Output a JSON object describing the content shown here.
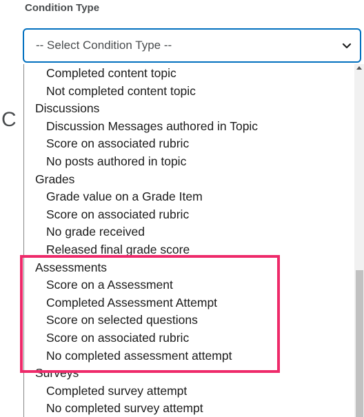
{
  "field_label": "Condition Type",
  "select": {
    "value": "-- Select Condition Type --",
    "chevron_icon": "chevron-down-icon"
  },
  "behind_letter": "C",
  "options": [
    {
      "type": "item",
      "label": "Completed content topic"
    },
    {
      "type": "item",
      "label": "Not completed content topic"
    },
    {
      "type": "group",
      "label": "Discussions"
    },
    {
      "type": "item",
      "label": "Discussion Messages authored in Topic"
    },
    {
      "type": "item",
      "label": "Score on associated rubric"
    },
    {
      "type": "item",
      "label": "No posts authored in topic"
    },
    {
      "type": "group",
      "label": "Grades"
    },
    {
      "type": "item",
      "label": "Grade value on a Grade Item"
    },
    {
      "type": "item",
      "label": "Score on associated rubric"
    },
    {
      "type": "item",
      "label": "No grade received"
    },
    {
      "type": "item",
      "label": "Released final grade score"
    },
    {
      "type": "group",
      "label": "Assessments"
    },
    {
      "type": "item",
      "label": "Score on a Assessment"
    },
    {
      "type": "item",
      "label": "Completed Assessment Attempt"
    },
    {
      "type": "item",
      "label": "Score on selected questions"
    },
    {
      "type": "item",
      "label": "Score on associated rubric"
    },
    {
      "type": "item",
      "label": "No completed assessment attempt"
    },
    {
      "type": "group",
      "label": "Surveys"
    },
    {
      "type": "item",
      "label": "Completed survey attempt"
    },
    {
      "type": "item",
      "label": "No completed survey attempt"
    }
  ],
  "highlight_color": "#ee2a6a",
  "focus_color": "#006fbf"
}
